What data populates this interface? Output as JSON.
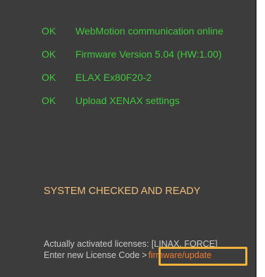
{
  "status": {
    "items": [
      {
        "code": "OK",
        "message": "WebMotion communication online"
      },
      {
        "code": "OK",
        "message": "Firmware Version 5.04 (HW:1.00)"
      },
      {
        "code": "OK",
        "message": "ELAX Ex80F20-2"
      },
      {
        "code": "OK",
        "message": "Upload XENAX settings"
      }
    ]
  },
  "system": {
    "ready_text": "SYSTEM CHECKED AND READY"
  },
  "licenses": {
    "active_text": "Actually activated licenses: [LINAX, FORCE]",
    "enter_label": "Enter new License Code",
    "arrow": ">",
    "link_label": "firmware/update"
  },
  "colors": {
    "ok_green": "#41c83d",
    "ready_orange": "#f0be78",
    "link_orange": "#f07c33",
    "highlight": "#f2b33b",
    "panel_bg": "#3c3c3c"
  }
}
